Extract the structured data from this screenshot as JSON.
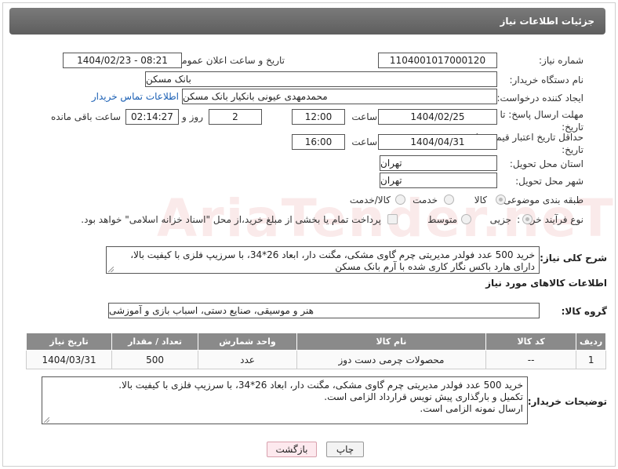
{
  "header": {
    "title": "جزئیات اطلاعات نیاز"
  },
  "fields": {
    "need_number_label": "شماره نیاز:",
    "need_number": "1104001017000120",
    "announce_label": "تاریخ و ساعت اعلان عمومی:",
    "announce_value": "1404/02/23 - 08:21",
    "buyer_org_label": "نام دستگاه خریدار:",
    "buyer_org": "بانک مسکن",
    "creator_label": "ایجاد کننده درخواست:",
    "creator": "محمدمهدی عیونی بانکیار بانک مسکن",
    "contact_link": "اطلاعات تماس خریدار",
    "deadline_label": "مهلت ارسال پاسخ: تا تاریخ:",
    "deadline_date": "1404/02/25",
    "time_label": "ساعت",
    "deadline_time": "12:00",
    "days_value": "2",
    "days_label": "روز و",
    "remaining_time": "02:14:27",
    "remaining_label": "ساعت باقی مانده",
    "validity_label": "حداقل تاریخ اعتبار قیمت: تا تاریخ:",
    "validity_date": "1404/04/31",
    "validity_time": "16:00",
    "province_label": "استان محل تحویل:",
    "province": "تهران",
    "city_label": "شهر محل تحویل:",
    "city": "تهران",
    "category_label": "طبقه بندی موضوعی:",
    "category_options": [
      "کالا",
      "خدمت",
      "کالا/خدمت"
    ],
    "process_label": "نوع فرآیند خرید :",
    "process_options": [
      "جزیی",
      "متوسط"
    ],
    "payment_note": "پرداخت تمام یا بخشی از مبلغ خرید،از محل \"اسناد خزانه اسلامی\" خواهد بود.",
    "description_label": "شرح کلی نیاز:",
    "description": "خرید 500 عدد فولدر مدیریتی چرم گاوی مشکی، مگنت دار، ابعاد 26*34، با سرزیپ فلزی با کیفیت بالا، دارای هارد باکس نگار کاری شده با آرم بانک مسکن",
    "goods_info_label": "اطلاعات کالاهای مورد نیاز",
    "goods_group_label": "گروه کالا:",
    "goods_group": "هنر و موسیقی، صنایع دستی، اسباب بازی و آموزشی"
  },
  "table": {
    "headers": [
      "ردیف",
      "کد کالا",
      "نام کالا",
      "واحد شمارش",
      "تعداد / مقدار",
      "تاریخ نیاز"
    ],
    "rows": [
      [
        "1",
        "--",
        "محصولات چرمی دست دوز",
        "عدد",
        "500",
        "1404/03/31"
      ]
    ]
  },
  "buyer_notes": {
    "label": "توضیحات خریدار:",
    "text": "خرید 500 عدد فولدر مدیریتی چرم گاوی مشکی، مگنت دار، ابعاد 26*34، با سرزیپ فلزی با کیفیت بالا.\nتکمیل و بارگذاری پیش نویس قرارداد الزامی است.\nارسال نمونه الزامی است."
  },
  "buttons": {
    "print": "چاپ",
    "back": "بازگشت"
  },
  "watermark": "AriaTender.neT"
}
